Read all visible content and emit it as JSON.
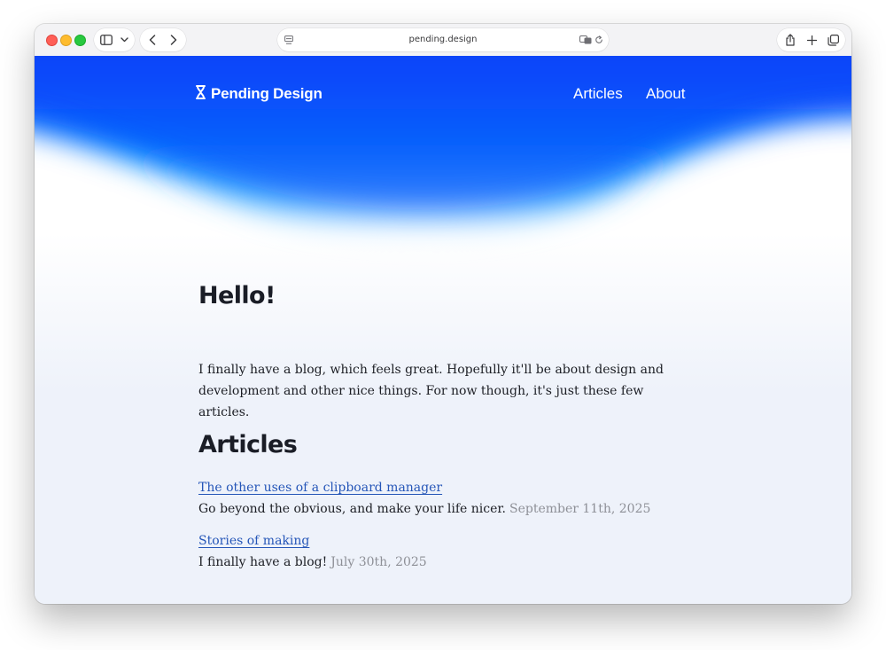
{
  "browser": {
    "url": "pending.design",
    "icons": [
      "sidebar-icon",
      "chevron-down-icon",
      "back-icon",
      "forward-icon",
      "site-settings-icon",
      "translate-icon",
      "reload-icon",
      "share-icon",
      "new-tab-icon",
      "tab-overview-icon"
    ]
  },
  "site": {
    "brand": "Pending Design",
    "nav": [
      "Articles",
      "About"
    ],
    "colors": {
      "hero_top": "#1533f5",
      "hero_mid": "#0084ff",
      "link": "#2556b8",
      "date": "#8e9097"
    }
  },
  "main": {
    "greeting": "Hello!",
    "intro": "I finally have a blog, which feels great. Hopefully it'll be about design and development and other nice things. For now though, it's just these few articles.",
    "articles_heading": "Articles",
    "articles": [
      {
        "title": "The other uses of a clipboard manager",
        "summary": "Go beyond the obvious, and make your life nicer.",
        "date": "September 11th, 2025"
      },
      {
        "title": "Stories of making",
        "summary": "I finally have a blog!",
        "date": "July 30th, 2025"
      }
    ]
  }
}
